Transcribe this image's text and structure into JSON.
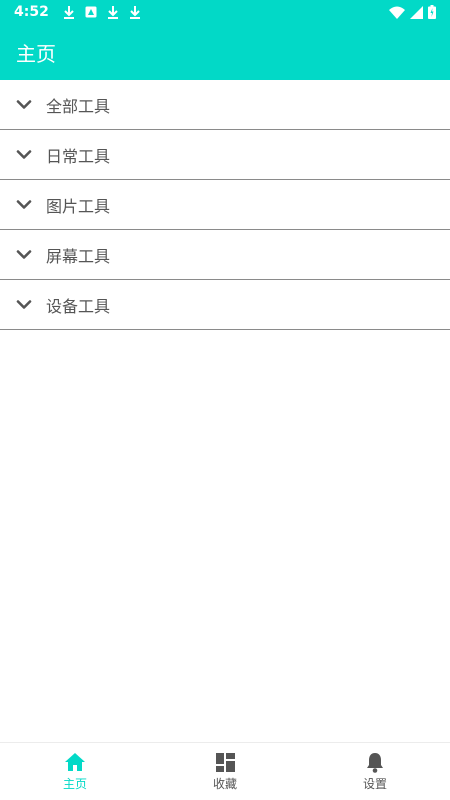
{
  "status_bar": {
    "time": "4:52",
    "left_icons": [
      "download-icon",
      "screenshot-icon",
      "download-icon",
      "download-icon"
    ],
    "right_icons": [
      "wifi-icon",
      "signal-icon",
      "battery-icon"
    ]
  },
  "app_bar": {
    "title": "主页"
  },
  "categories": [
    {
      "label": "全部工具",
      "icon": "chevron-down-icon"
    },
    {
      "label": "日常工具",
      "icon": "chevron-down-icon"
    },
    {
      "label": "图片工具",
      "icon": "chevron-down-icon"
    },
    {
      "label": "屏幕工具",
      "icon": "chevron-down-icon"
    },
    {
      "label": "设备工具",
      "icon": "chevron-down-icon"
    }
  ],
  "bottom_nav": {
    "items": [
      {
        "label": "主页",
        "icon": "home-icon",
        "active": true
      },
      {
        "label": "收藏",
        "icon": "dashboard-icon",
        "active": false
      },
      {
        "label": "设置",
        "icon": "bell-icon",
        "active": false
      }
    ]
  },
  "colors": {
    "accent": "#02d9c7",
    "divider": "#8a8a8a",
    "text": "#555555",
    "icon_inactive": "#555555"
  }
}
